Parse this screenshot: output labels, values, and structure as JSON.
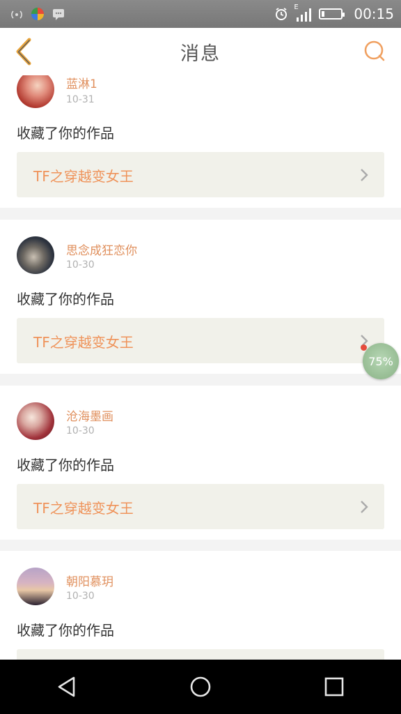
{
  "status_bar": {
    "time": "00:15",
    "icons": [
      "wifi-signal-icon",
      "color-app-icon",
      "message-icon",
      "alarm-icon",
      "cell-signal-icon",
      "battery-icon"
    ],
    "edge_indicator": "E"
  },
  "header": {
    "title": "消息",
    "back_icon": "chevron-left-icon",
    "chat_icon": "chat-bubble-icon",
    "accent_color": "#e8a33a"
  },
  "messages": [
    {
      "username": "蓝淋1",
      "date": "10-31",
      "action": "收藏了你的作品",
      "work_title": "TF之穿越变女王"
    },
    {
      "username": "思念成狂恋你",
      "date": "10-30",
      "action": "收藏了你的作品",
      "work_title": "TF之穿越变女王"
    },
    {
      "username": "沧海墨画",
      "date": "10-30",
      "action": "收藏了你的作品",
      "work_title": "TF之穿越变女王"
    },
    {
      "username": "朝阳慕玥",
      "date": "10-30",
      "action": "收藏了你的作品",
      "work_title": ""
    }
  ],
  "progress_bubble": {
    "label": "75%",
    "value": 75
  },
  "nav": {
    "back_icon": "triangle-back-icon",
    "home_icon": "circle-home-icon",
    "recents_icon": "square-recents-icon"
  }
}
